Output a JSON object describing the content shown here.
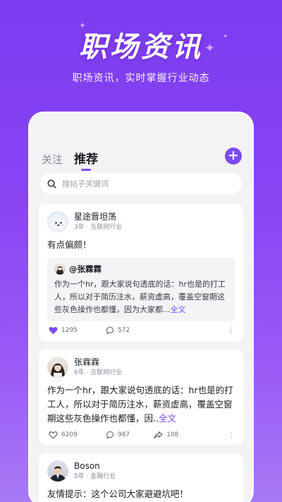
{
  "hero": {
    "title": "职场资讯",
    "subtitle": "职场资讯，实时掌握行业动态"
  },
  "tabs": [
    {
      "label": "关注",
      "active": false
    },
    {
      "label": "推荐",
      "active": true
    }
  ],
  "add_button_icon": "plus-icon",
  "search": {
    "placeholder": "搜帖子关键词"
  },
  "posts": [
    {
      "user": "星途晋坦荡",
      "meta": "3年 · 互联网行业",
      "text": "有点偏颇！",
      "quote": {
        "user": "@张霖霖",
        "text": "作为一个hr，跟大家说句透底的话：hr也是的打工人，所以对于简历注水，薪资虚高，覆盖空窗期这些灰色操作也都懂，因为大家都...",
        "more": "全文"
      },
      "likes": "1295",
      "comments": "572",
      "liked": true
    },
    {
      "user": "张霖霖",
      "meta": "6年 · 互联网行业",
      "text": "作为一个hr，跟大家说句透底的话：hr也是的打工人，所以对于简历注水，薪资虚高，覆盖空窗期这些灰色操作也都懂，因..",
      "more": "全文",
      "likes": "6209",
      "comments": "987",
      "shares": "108",
      "liked": false
    },
    {
      "user": "Boson",
      "meta": "5年 · 金融行业",
      "text": "友情提示：这个公司大家避避坑吧！"
    }
  ],
  "colors": {
    "accent": "#7d4bf2",
    "background_top": "#7b3cf0",
    "background_bottom": "#a77af5"
  }
}
